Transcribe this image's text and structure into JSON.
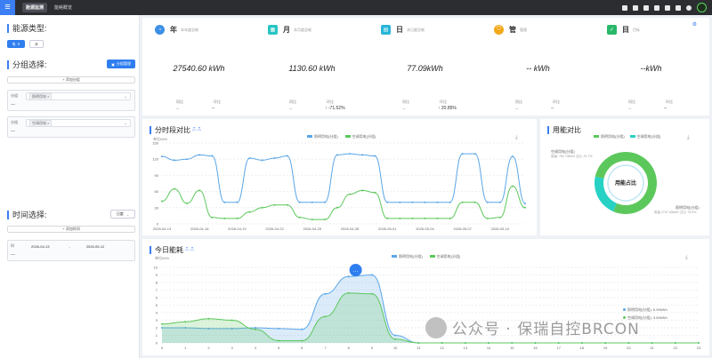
{
  "topbar": {
    "menu_glyph": "≡",
    "brand": "能源监测",
    "breadcrumb": "能耗概览"
  },
  "left": {
    "energy_type_title": "能源类型:",
    "energy_buttons": [
      "电",
      "水"
    ],
    "group_title": "分组选择:",
    "manage_button": "分组管理",
    "add_group_label": "+ 添加分组",
    "groups": [
      {
        "label": "分组",
        "dash": "—",
        "tag": "照明用电 ×"
      },
      {
        "label": "分组",
        "dash": "—",
        "tag": "空调用电 ×"
      }
    ],
    "time_title": "时间选择:",
    "time_mode": "日度",
    "add_time_label": "+ 添加时间",
    "time_range": {
      "label": "时",
      "dash": "—",
      "start": "2026-04-13",
      "sep": "-",
      "end": "2026-05-12"
    }
  },
  "cards": [
    {
      "title": "年",
      "subtitle": "本年度总耗",
      "value": "27540.60 kWh",
      "l1": "同比",
      "l2": "环比",
      "v1": "--",
      "v2": "--",
      "color": "#3c8fe6"
    },
    {
      "title": "月",
      "subtitle": "本月度总耗",
      "value": "1130.60 kWh",
      "l1": "同比",
      "l2": "环比",
      "v1": "--",
      "v2": "↑ -71.52%",
      "color": "#27c4c4"
    },
    {
      "title": "日",
      "subtitle": "本日度总耗",
      "value": "77.09kWh",
      "l1": "同比",
      "l2": "环比",
      "v1": "--",
      "v2": "↑ 20.85%",
      "color": "#27b5d8"
    },
    {
      "title": "管",
      "subtitle": "管理",
      "value": "-- kWh",
      "l1": "同比",
      "l2": "环比",
      "v1": "--",
      "v2": "--",
      "color": "#f2a818"
    },
    {
      "title": "目",
      "subtitle": "目标",
      "value": "--kWh",
      "l1": "同比",
      "l2": "环比",
      "v1": "--",
      "v2": "--",
      "color": "#2ab86a"
    }
  ],
  "colors": {
    "blue": "#5aa6e8",
    "green": "#5cc85c"
  },
  "chart_data": [
    {
      "type": "line",
      "title": "分时段对比",
      "ylabel": "单位kWh",
      "ylim": [
        0,
        150
      ],
      "yticks": [
        0,
        30,
        60,
        90,
        120,
        150
      ],
      "x": [
        "2026-04-13",
        "2026-04-14",
        "2026-04-15",
        "2026-04-16",
        "2026-04-17",
        "2026-04-18",
        "2026-04-19",
        "2026-04-20",
        "2026-04-21",
        "2026-04-22",
        "2026-04-23",
        "2026-04-24",
        "2026-04-25",
        "2026-04-26",
        "2026-04-27",
        "2026-04-28",
        "2026-04-29",
        "2026-04-30",
        "2026-05-01",
        "2026-05-02",
        "2026-05-03",
        "2026-05-04",
        "2026-05-05",
        "2026-05-06",
        "2026-05-07",
        "2026-05-08",
        "2026-05-09",
        "2026-05-10",
        "2026-05-11",
        "2026-05-12"
      ],
      "xticks": [
        "2026-04-13",
        "2026-04-16",
        "2026-04-19",
        "2026-04-22",
        "2026-04-25",
        "2026-04-28",
        "2026-05-01",
        "2026-05-04",
        "2026-05-07",
        "2026-05-10"
      ],
      "series": [
        {
          "name": "照明用电(分组)",
          "values": [
            125,
            118,
            120,
            128,
            126,
            40,
            40,
            122,
            118,
            122,
            126,
            40,
            40,
            40,
            128,
            130,
            128,
            126,
            40,
            40,
            40,
            40,
            40,
            40,
            130,
            130,
            40,
            40,
            125,
            38
          ]
        },
        {
          "name": "空调用电(分组)",
          "values": [
            42,
            65,
            38,
            62,
            12,
            10,
            10,
            22,
            30,
            35,
            35,
            12,
            8,
            8,
            30,
            55,
            62,
            58,
            10,
            10,
            10,
            10,
            10,
            10,
            40,
            40,
            10,
            12,
            70,
            30
          ]
        }
      ]
    },
    {
      "type": "pie",
      "title": "用能对比",
      "center_label": "用能占比",
      "slices": [
        {
          "name": "照明用电(分组)",
          "value": 2747.4,
          "label": "照明用电(分组)",
          "label2": "用量 2747.40kWh 占比: 78.3%"
        },
        {
          "name": "空调用电(分组)",
          "value": 762.7,
          "label": "空调用电(分组)",
          "label2": "用量: 762.70kWh 占比: 21.7%"
        }
      ]
    },
    {
      "type": "area",
      "title": "今日能耗",
      "ylabel": "单位kWh",
      "ylim": [
        0,
        10
      ],
      "yticks": [
        0,
        1,
        2,
        3,
        4,
        5,
        6,
        7,
        8,
        9,
        10
      ],
      "x": [
        0,
        1,
        2,
        3,
        4,
        5,
        6,
        7,
        8,
        9,
        10,
        11,
        12,
        13,
        14,
        15,
        16,
        17,
        18,
        19,
        20,
        21,
        22,
        23
      ],
      "series": [
        {
          "name": "照明用电(分组)",
          "values": [
            2.0,
            2.0,
            1.9,
            1.9,
            2.0,
            1.9,
            1.8,
            6.5,
            8.8,
            9.0,
            1.0,
            0,
            0,
            0,
            0,
            0,
            0,
            0,
            0,
            0,
            0,
            0,
            0,
            0
          ]
        },
        {
          "name": "空调用电(分组)",
          "values": [
            2.5,
            2.8,
            3.2,
            3.0,
            1.8,
            0.3,
            0.3,
            3.5,
            6.6,
            6.5,
            0.5,
            0,
            0,
            0,
            0,
            0,
            0,
            0,
            0,
            0,
            0,
            0,
            0,
            0
          ]
        }
      ],
      "tooltip": [
        "照明用电(分组): 6.90kWh",
        "空调用电(分组): 3.60kWh"
      ]
    }
  ],
  "watermark": "公众号 · 保瑞自控BRCON"
}
